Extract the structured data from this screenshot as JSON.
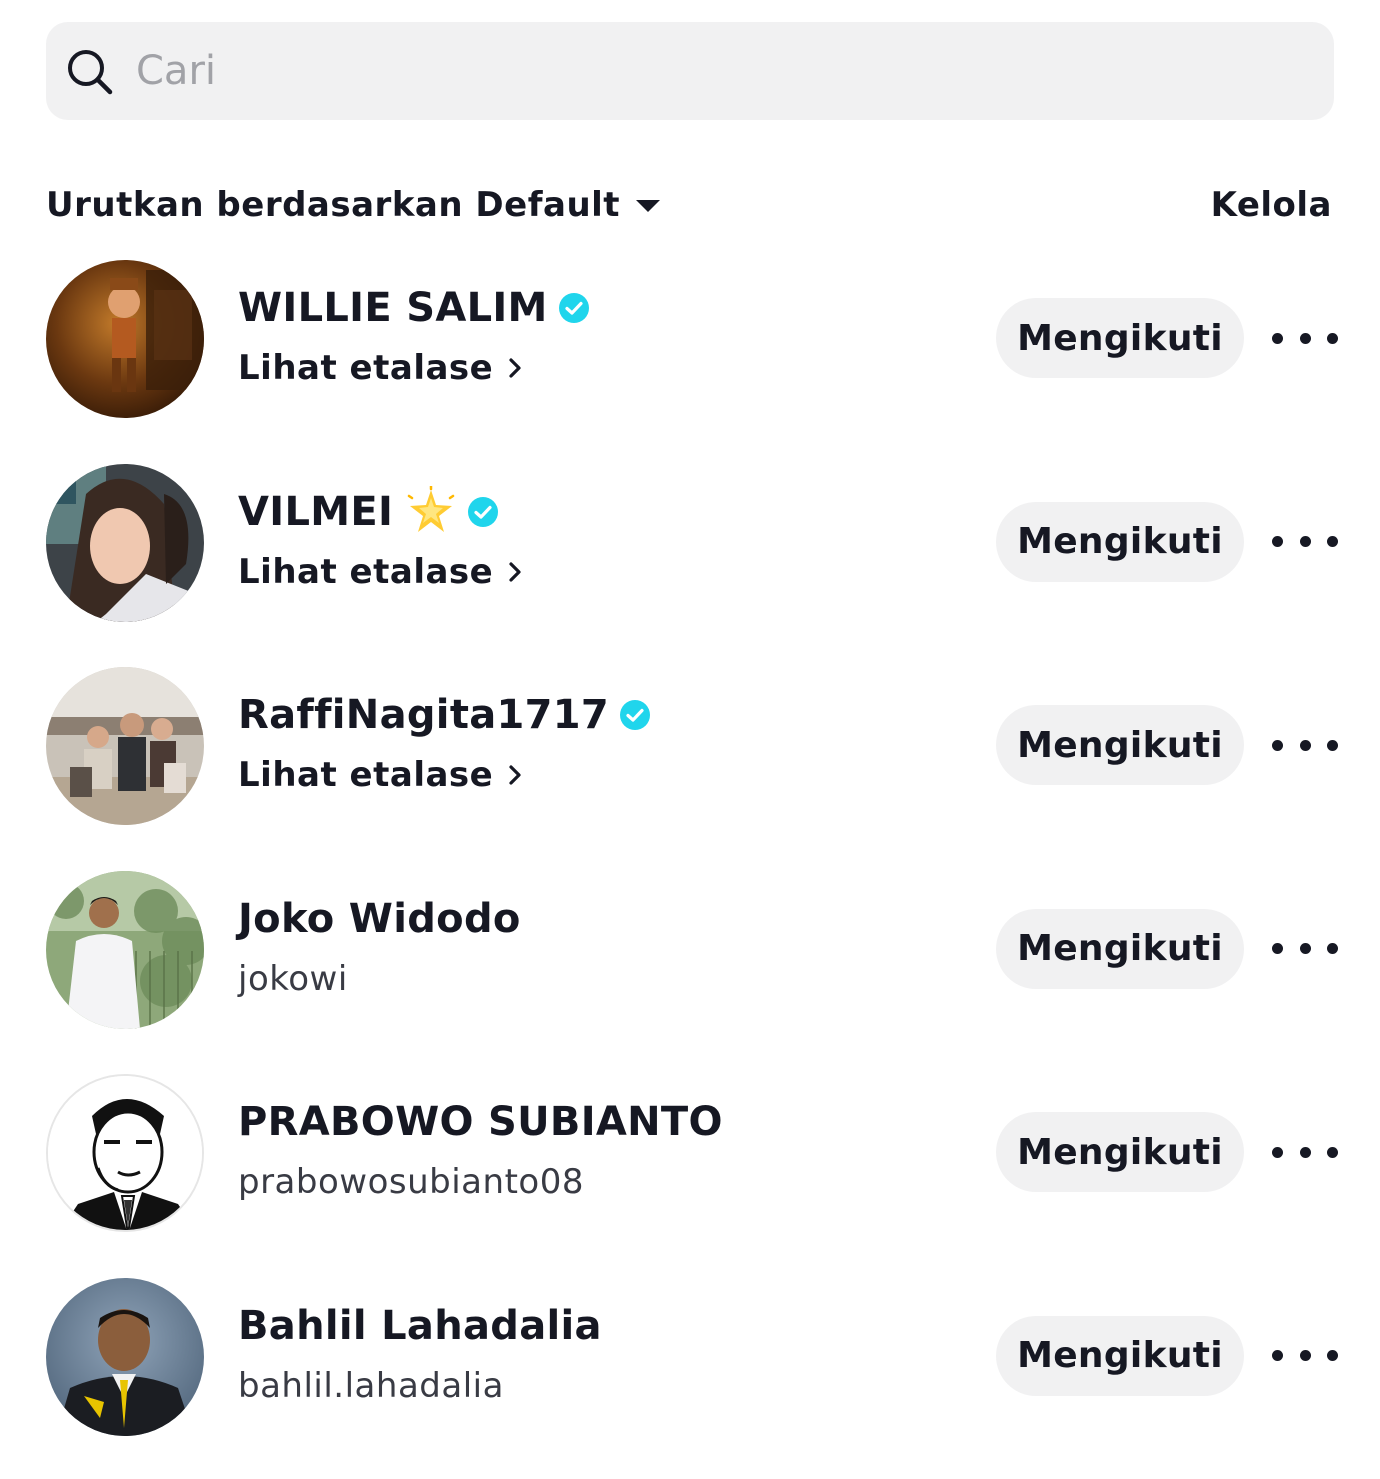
{
  "search": {
    "placeholder": "Cari"
  },
  "sort": {
    "label": "Urutkan berdasarkan Default",
    "manage_label": "Kelola"
  },
  "colors": {
    "verified": "#20d5ec",
    "button_bg": "#f1f1f2",
    "text": "#161823"
  },
  "users": [
    {
      "name": "WILLIE SALIM",
      "verified": true,
      "emoji": "",
      "subtitle_type": "shop",
      "subtitle": "Lihat etalase",
      "follow_label": "Mengikuti"
    },
    {
      "name": "VILMEI",
      "verified": true,
      "emoji": "glowing-star",
      "subtitle_type": "shop",
      "subtitle": "Lihat etalase",
      "follow_label": "Mengikuti"
    },
    {
      "name": "RaffiNagita1717",
      "verified": true,
      "emoji": "",
      "subtitle_type": "shop",
      "subtitle": "Lihat etalase",
      "follow_label": "Mengikuti"
    },
    {
      "name": "Joko Widodo",
      "verified": false,
      "emoji": "",
      "subtitle_type": "username",
      "subtitle": "jokowi",
      "follow_label": "Mengikuti"
    },
    {
      "name": "PRABOWO SUBIANTO",
      "verified": false,
      "emoji": "",
      "subtitle_type": "username",
      "subtitle": "prabowosubianto08",
      "follow_label": "Mengikuti"
    },
    {
      "name": "Bahlil Lahadalia",
      "verified": false,
      "emoji": "",
      "subtitle_type": "username",
      "subtitle": "bahlil.lahadalia",
      "follow_label": "Mengikuti"
    }
  ]
}
